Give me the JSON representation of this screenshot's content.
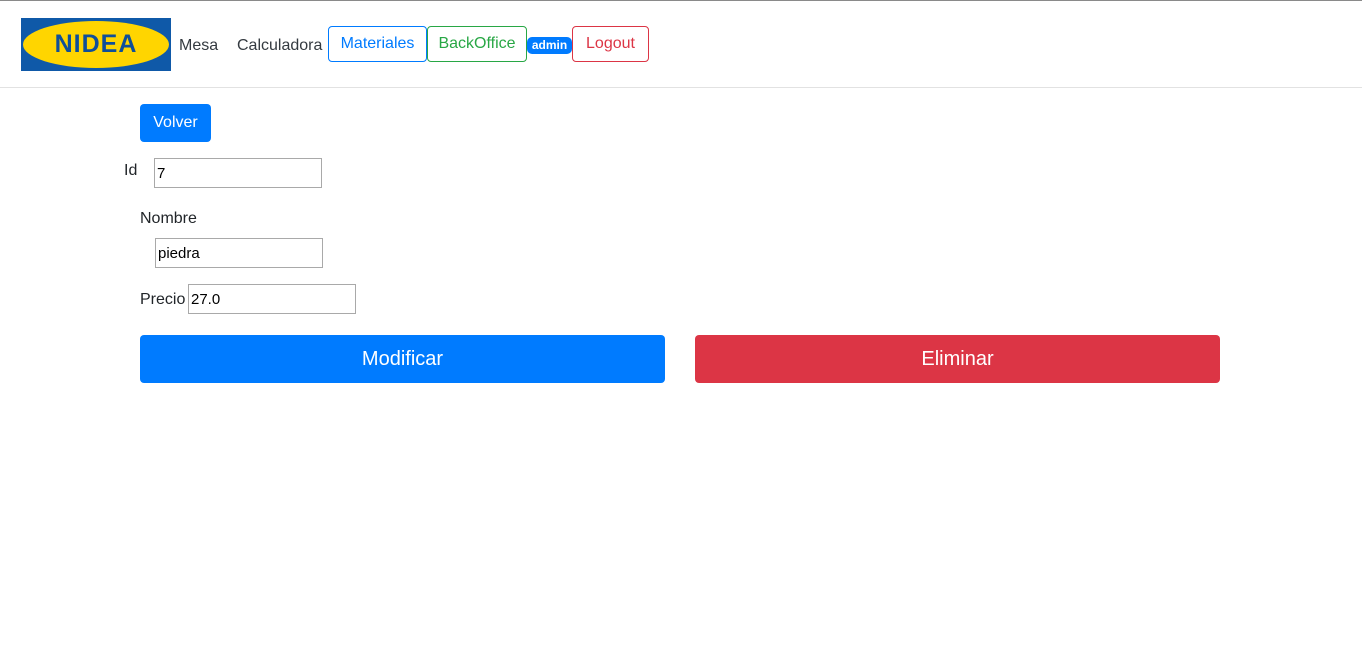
{
  "nav": {
    "logo_text": "NIDEA",
    "mesa": "Mesa",
    "calculadora": "Calculadora",
    "materiales": "Materiales",
    "backoffice": "BackOffice",
    "user_badge": "admin",
    "logout": "Logout"
  },
  "form": {
    "volver": "Volver",
    "id_label": "Id",
    "id_value": "7",
    "nombre_label": "Nombre",
    "nombre_value": "piedra",
    "precio_label": "Precio",
    "precio_value": "27.0",
    "modificar": "Modificar",
    "eliminar": "Eliminar"
  },
  "colors": {
    "primary": "#007bff",
    "success": "#28a745",
    "danger": "#dc3545",
    "logo_blue": "#0f59a8",
    "logo_yellow": "#ffd500"
  }
}
